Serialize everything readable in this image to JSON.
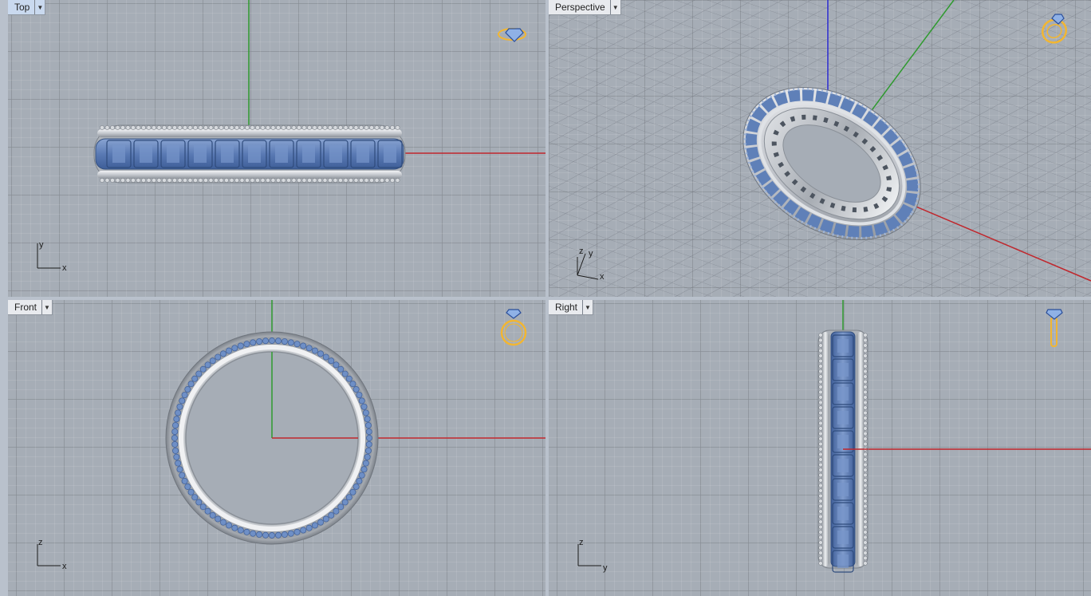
{
  "viewports": {
    "top": {
      "label": "Top",
      "axis_h": "x",
      "axis_v": "y"
    },
    "persp": {
      "label": "Perspective",
      "axis_h": "x",
      "axis_v": "y",
      "axis_z": "z"
    },
    "front": {
      "label": "Front",
      "axis_h": "x",
      "axis_v": "z"
    },
    "right": {
      "label": "Right",
      "axis_h": "y",
      "axis_v": "z"
    }
  },
  "colors": {
    "viewport_bg": "#a6adb6",
    "axis_x": "#c0272d",
    "axis_y": "#2f9a2f",
    "axis_z": "#2b2bd0",
    "metal": "#d0d3d8",
    "gem": "#5e7fb8",
    "active_tab": "#c9d9ef",
    "gizmo": "#f2b632"
  },
  "icons": {
    "caret": "▼"
  }
}
